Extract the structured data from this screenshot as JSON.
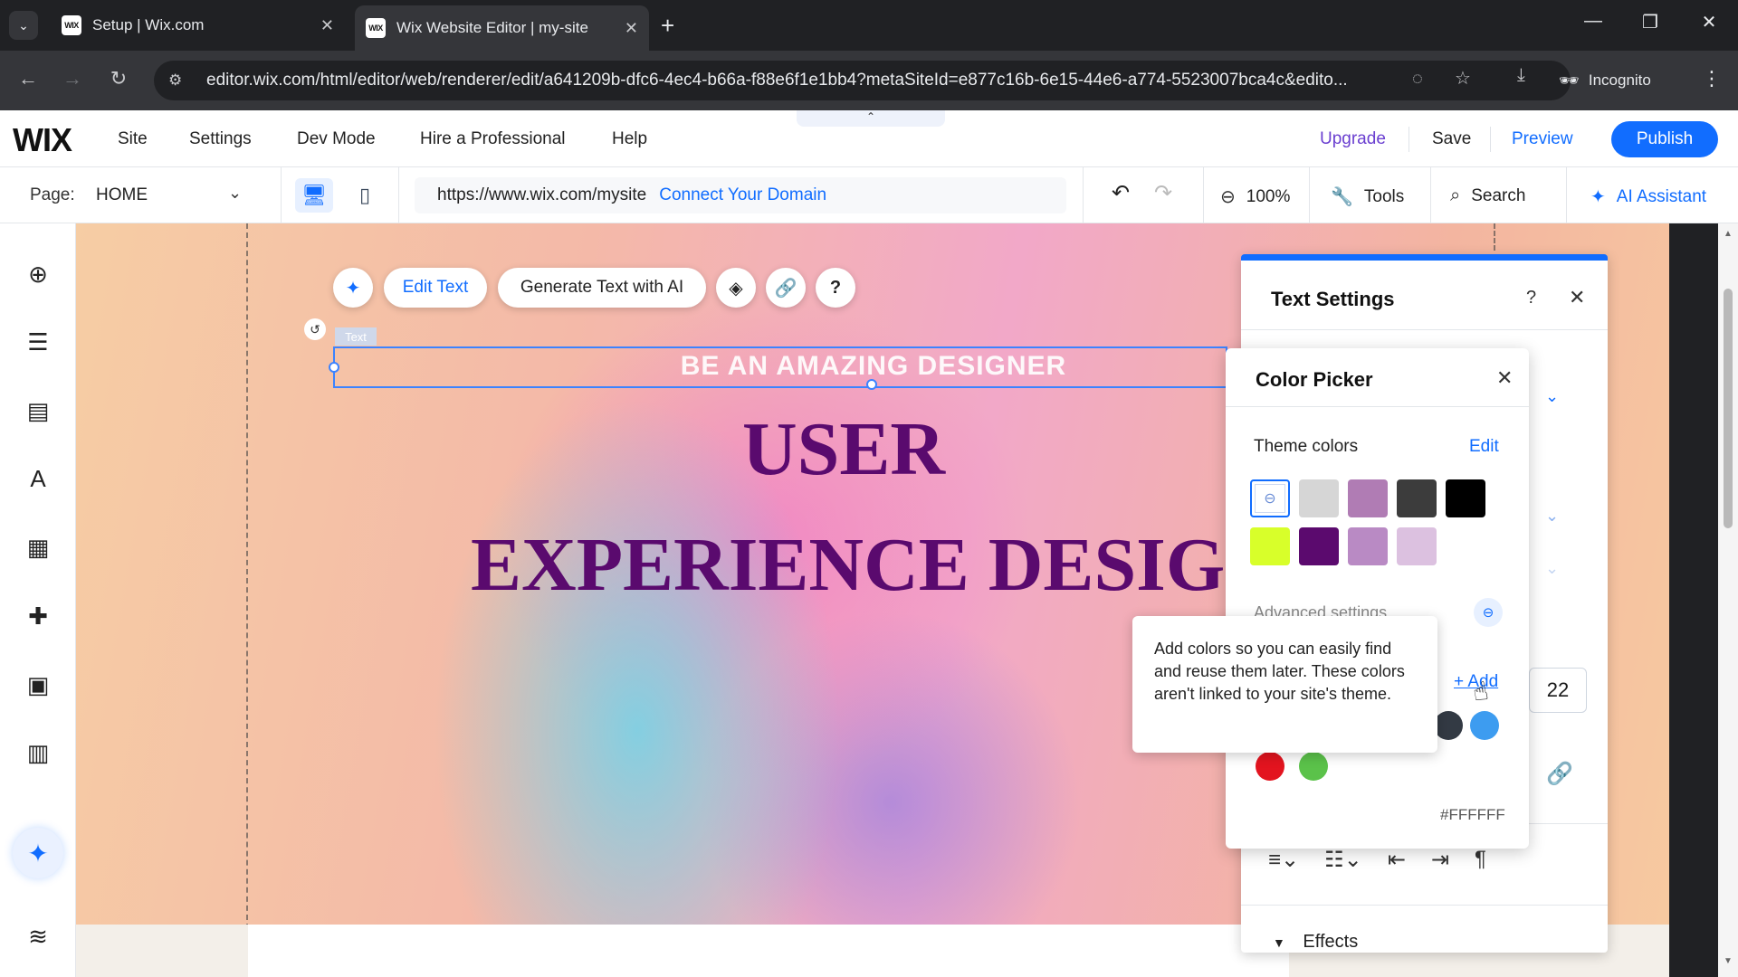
{
  "browser": {
    "tabs": [
      {
        "title": "Setup | Wix.com",
        "favicon": "WIX",
        "active": false
      },
      {
        "title": "Wix Website Editor | my-site",
        "favicon": "WIX",
        "active": true
      }
    ],
    "url": "editor.wix.com/html/editor/web/renderer/edit/a641209b-dfc6-4ec4-b66a-f88e6f1e1bb4?metaSiteId=e877c16b-6e15-44e6-a774-5523007bca4c&edito...",
    "incognito_label": "Incognito"
  },
  "editor": {
    "logo": "WIX",
    "menu": [
      "Site",
      "Settings",
      "Dev Mode",
      "Hire a Professional",
      "Help"
    ],
    "upgrade": "Upgrade",
    "save": "Save",
    "preview": "Preview",
    "publish": "Publish",
    "page_label": "Page:",
    "page_value": "HOME",
    "site_url": "https://www.wix.com/mysite",
    "connect_domain": "Connect Your Domain",
    "zoom": "100%",
    "tools": "Tools",
    "search": "Search",
    "ai_assistant": "AI Assistant",
    "accent_color": "#116dff"
  },
  "canvas": {
    "float_toolbar": {
      "edit_text": "Edit Text",
      "generate_text": "Generate Text with AI"
    },
    "text_tag": "Text",
    "tagline": "BE AN AMAZING DESIGNER",
    "headline_1": "USER",
    "headline_2": "EXPERIENCE DESIGNER",
    "headline_color": "#5a0a6e"
  },
  "text_settings": {
    "title": "Text Settings",
    "font_size": "22",
    "effects": "Effects"
  },
  "color_picker": {
    "title": "Color Picker",
    "theme_colors_label": "Theme colors",
    "edit": "Edit",
    "theme_colors": [
      "#ffffff",
      "#d6d6d6",
      "#b07cb4",
      "#3c3c3c",
      "#000000",
      "#d8ff2a",
      "#5b0a6e",
      "#b98ac4",
      "#dcc1e0"
    ],
    "advanced_settings": "Advanced settings",
    "add_label": "+ Add",
    "custom_colors": [
      "#333a44",
      "#3d9cf0",
      "#e3141f",
      "#5bc24a"
    ],
    "hex_value": "#FFFFFF",
    "tooltip": "Add colors so you can easily find and reuse them later. These colors aren't linked to your site's theme."
  }
}
